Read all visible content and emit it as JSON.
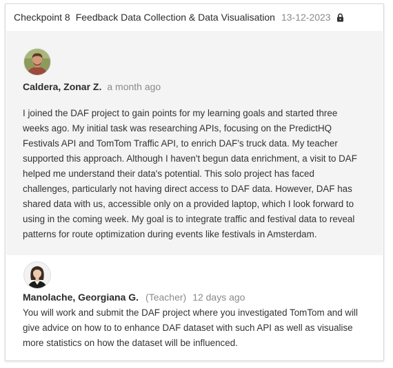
{
  "checkpoint": {
    "label": "Checkpoint 8",
    "title": "Feedback Data Collection & Data Visualisation",
    "date": "13-12-2023",
    "status_icon": "lock-icon"
  },
  "comments": [
    {
      "author": "Caldera, Zonar Z.",
      "role": "",
      "time": "a month ago",
      "avatar_icon": "user-avatar-photo",
      "lines": [
        "I joined the DAF project to gain points for my learning goals and started three",
        "weeks ago. My initial task was researching APIs, focusing on the PredictHQ",
        "Festivals API and TomTom Traffic API, to enrich DAF's truck data. My teacher",
        "supported this approach. Although I haven't begun data enrichment, a visit to DAF",
        "helped me understand their data's potential. This solo project has faced",
        "challenges, particularly not having direct access to DAF data. However, DAF has",
        "shared data with us, accessible only on a provided laptop, which I look forward to",
        "using in the coming week. My goal is to integrate traffic and festival data to reveal",
        "patterns for route optimization during events like festivals in Amsterdam."
      ]
    },
    {
      "author": "Manolache, Georgiana G.",
      "role": "(Teacher)",
      "time": "12 days ago",
      "avatar_icon": "user-avatar-photo",
      "lines": [
        "You will work and submit the DAF project where you investigated TomTom and will",
        "give advice on how to to enhance DAF dataset with such API as well as visualise",
        "more statistics on how the dataset will be influenced."
      ]
    }
  ],
  "colors": {
    "highlight_background": "#f4f4f4",
    "muted_text": "#8a8a8a",
    "body_text": "#323232"
  }
}
